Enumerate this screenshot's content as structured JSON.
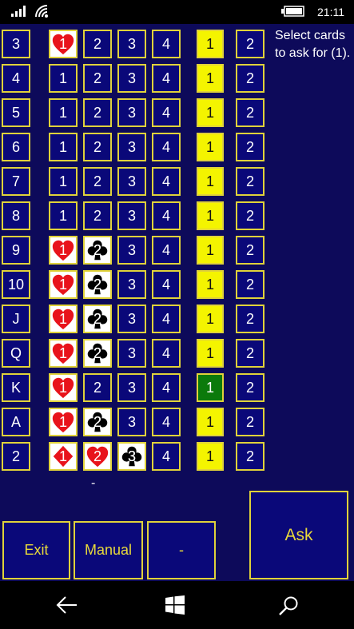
{
  "status": {
    "time": "21:11"
  },
  "prompt": "Select cards to ask for (1).",
  "dash_note": "-",
  "rows": [
    {
      "rank": "3",
      "c1": {
        "t": "1",
        "s": "heart"
      },
      "c2": {
        "t": "2"
      },
      "c3": {
        "t": "3"
      },
      "c4": "4",
      "count": "1",
      "count_state": "yellow",
      "last": "2"
    },
    {
      "rank": "4",
      "c1": {
        "t": "1"
      },
      "c2": {
        "t": "2"
      },
      "c3": {
        "t": "3"
      },
      "c4": "4",
      "count": "1",
      "count_state": "yellow",
      "last": "2"
    },
    {
      "rank": "5",
      "c1": {
        "t": "1"
      },
      "c2": {
        "t": "2"
      },
      "c3": {
        "t": "3"
      },
      "c4": "4",
      "count": "1",
      "count_state": "yellow",
      "last": "2"
    },
    {
      "rank": "6",
      "c1": {
        "t": "1"
      },
      "c2": {
        "t": "2"
      },
      "c3": {
        "t": "3"
      },
      "c4": "4",
      "count": "1",
      "count_state": "yellow",
      "last": "2"
    },
    {
      "rank": "7",
      "c1": {
        "t": "1"
      },
      "c2": {
        "t": "2"
      },
      "c3": {
        "t": "3"
      },
      "c4": "4",
      "count": "1",
      "count_state": "yellow",
      "last": "2"
    },
    {
      "rank": "8",
      "c1": {
        "t": "1"
      },
      "c2": {
        "t": "2"
      },
      "c3": {
        "t": "3"
      },
      "c4": "4",
      "count": "1",
      "count_state": "yellow",
      "last": "2"
    },
    {
      "rank": "9",
      "c1": {
        "t": "1",
        "s": "heart"
      },
      "c2": {
        "t": "2",
        "s": "club"
      },
      "c3": {
        "t": "3"
      },
      "c4": "4",
      "count": "1",
      "count_state": "yellow",
      "last": "2"
    },
    {
      "rank": "10",
      "c1": {
        "t": "1",
        "s": "heart"
      },
      "c2": {
        "t": "2",
        "s": "club"
      },
      "c3": {
        "t": "3"
      },
      "c4": "4",
      "count": "1",
      "count_state": "yellow",
      "last": "2"
    },
    {
      "rank": "J",
      "c1": {
        "t": "1",
        "s": "heart"
      },
      "c2": {
        "t": "2",
        "s": "club"
      },
      "c3": {
        "t": "3"
      },
      "c4": "4",
      "count": "1",
      "count_state": "yellow",
      "last": "2"
    },
    {
      "rank": "Q",
      "c1": {
        "t": "1",
        "s": "heart"
      },
      "c2": {
        "t": "2",
        "s": "club"
      },
      "c3": {
        "t": "3"
      },
      "c4": "4",
      "count": "1",
      "count_state": "yellow",
      "last": "2"
    },
    {
      "rank": "K",
      "c1": {
        "t": "1",
        "s": "heart"
      },
      "c2": {
        "t": "2"
      },
      "c3": {
        "t": "3"
      },
      "c4": "4",
      "count": "1",
      "count_state": "green",
      "last": "2"
    },
    {
      "rank": "A",
      "c1": {
        "t": "1",
        "s": "heart"
      },
      "c2": {
        "t": "2",
        "s": "club"
      },
      "c3": {
        "t": "3"
      },
      "c4": "4",
      "count": "1",
      "count_state": "yellow",
      "last": "2"
    },
    {
      "rank": "2",
      "c1": {
        "t": "1",
        "s": "diamond"
      },
      "c2": {
        "t": "2",
        "s": "heart"
      },
      "c3": {
        "t": "3",
        "s": "club"
      },
      "c4": "4",
      "count": "1",
      "count_state": "yellow",
      "last": "2"
    }
  ],
  "buttons": {
    "exit": "Exit",
    "manual": "Manual",
    "dash": "-",
    "ask": "Ask"
  },
  "colors": {
    "background": "#0d0a5a",
    "cell": "#0a0879",
    "border": "#e0d23a",
    "highlight": "#f4f400",
    "selected": "#0b7a0b",
    "heart": "#e8131b"
  }
}
